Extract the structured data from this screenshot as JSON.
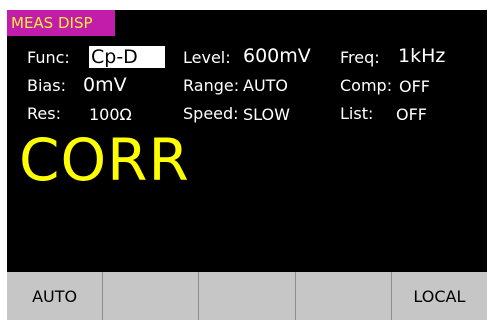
{
  "header": {
    "title": "MEAS DISP"
  },
  "params": {
    "func": {
      "label": "Func:",
      "value": "Cp-D"
    },
    "level": {
      "label": "Level:",
      "value": "600mV"
    },
    "freq": {
      "label": "Freq:",
      "value": "1kHz"
    },
    "bias": {
      "label": "Bias:",
      "value": "0mV"
    },
    "range": {
      "label": "Range:",
      "value": "AUTO"
    },
    "comp": {
      "label": "Comp:",
      "value": "OFF"
    },
    "res": {
      "label": "Res:",
      "value": "100Ω"
    },
    "speed": {
      "label": "Speed:",
      "value": "SLOW"
    },
    "list": {
      "label": "List:",
      "value": "OFF"
    }
  },
  "readout": {
    "text": "CORR"
  },
  "softkeys": [
    "AUTO",
    "",
    "",
    "",
    "LOCAL"
  ],
  "colors": {
    "screen_bg": "#000000",
    "title_bg": "#c21cab",
    "title_text": "#ffee3a",
    "readout": "#ffff00",
    "softkey_bg": "#c6c6c6"
  }
}
